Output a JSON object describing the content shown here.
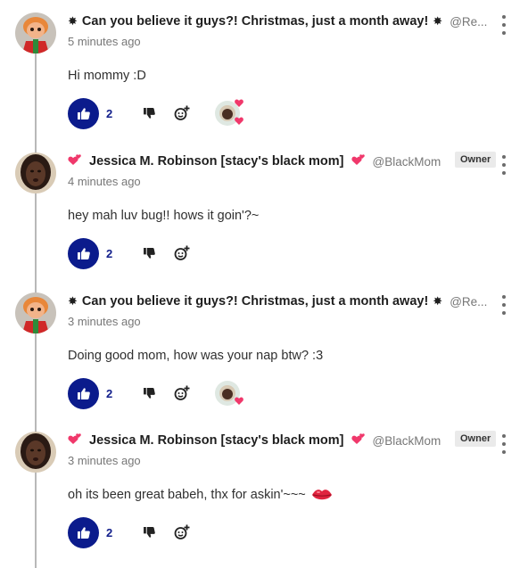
{
  "comments": [
    {
      "author_glyph": "✸",
      "author": "Can you believe it guys?! Christmas, just a month away!",
      "handle": "@Re...",
      "time": "5 minutes ago",
      "text": "Hi mommy :D",
      "likes": "2",
      "owner_badge": "",
      "reaction_icon": "creator-heart-reaction"
    },
    {
      "author_glyph": "💕",
      "author": "Jessica M. Robinson [stacy's black mom]",
      "handle": "@BlackMom",
      "time": "4 minutes ago",
      "text": "hey mah luv bug!! hows it goin'?~",
      "likes": "2",
      "owner_badge": "Owner"
    },
    {
      "author_glyph": "✸",
      "author": "Can you believe it guys?! Christmas, just a month away!",
      "handle": "@Re...",
      "time": "3 minutes ago",
      "text": "Doing good mom, how was your nap btw? :3",
      "likes": "2",
      "owner_badge": "",
      "reaction_icon": "creator-heart-reaction"
    },
    {
      "author_glyph": "💕",
      "author": "Jessica M. Robinson [stacy's black mom]",
      "handle": "@BlackMom",
      "time": "3 minutes ago",
      "text": "oh its been great babeh, thx for askin'~~~",
      "likes": "2",
      "owner_badge": "Owner",
      "trailing_emoji_icon": "lips-kiss-icon"
    }
  ],
  "colors": {
    "like_button_bg": "#0b1b8c",
    "like_count": "#13208c",
    "heart": "#f0386b",
    "thread_line": "#b8b8b8",
    "owner_badge_bg": "#eaeaea"
  }
}
